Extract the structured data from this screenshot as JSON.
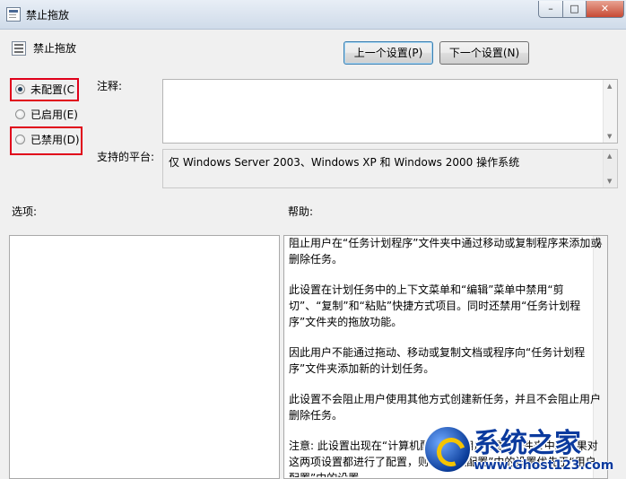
{
  "window": {
    "title": "禁止拖放",
    "minimize_glyph": "–",
    "maximize_glyph": "□",
    "close_glyph": "✕"
  },
  "setting": {
    "name": "禁止拖放"
  },
  "nav": {
    "prev_label": "上一个设置(P)",
    "next_label": "下一个设置(N)"
  },
  "state": {
    "options": [
      {
        "label": "未配置(C",
        "checked": true,
        "highlighted": true
      },
      {
        "label": "已启用(E)",
        "checked": false,
        "highlighted": false
      },
      {
        "label": "已禁用(D)",
        "checked": false,
        "highlighted": true
      }
    ]
  },
  "comment": {
    "label": "注释:",
    "value": ""
  },
  "supported": {
    "label": "支持的平台:",
    "value": "仅 Windows Server 2003、Windows XP 和 Windows 2000 操作系统"
  },
  "options_panel": {
    "label": "选项:"
  },
  "help": {
    "label": "帮助:",
    "paragraphs": [
      "阻止用户在“任务计划程序”文件夹中通过移动或复制程序来添加或删除任务。",
      "此设置在计划任务中的上下文菜单和“编辑”菜单中禁用“剪切”、“复制”和“粘贴”快捷方式项目。同时还禁用“任务计划程序”文件夹的拖放功能。",
      "因此用户不能通过拖动、移动或复制文档或程序向“任务计划程序”文件夹添加新的计划任务。",
      "此设置不会阻止用户使用其他方式创建新任务，并且不会阻止用户删除任务。",
      "注意: 此设置出现在“计算机配置”和“用户配置”文件夹中。如果对这两项设置都进行了配置，则“计算机配置”中的设置优先于“用户配置”中的设置。"
    ]
  },
  "watermark": {
    "brand": "系统之家",
    "url": "www.Ghost123.com"
  },
  "colors": {
    "highlight_border": "#e0001a",
    "window_bg": "#f0f0f0",
    "logo_blue": "#0b3a9e"
  }
}
